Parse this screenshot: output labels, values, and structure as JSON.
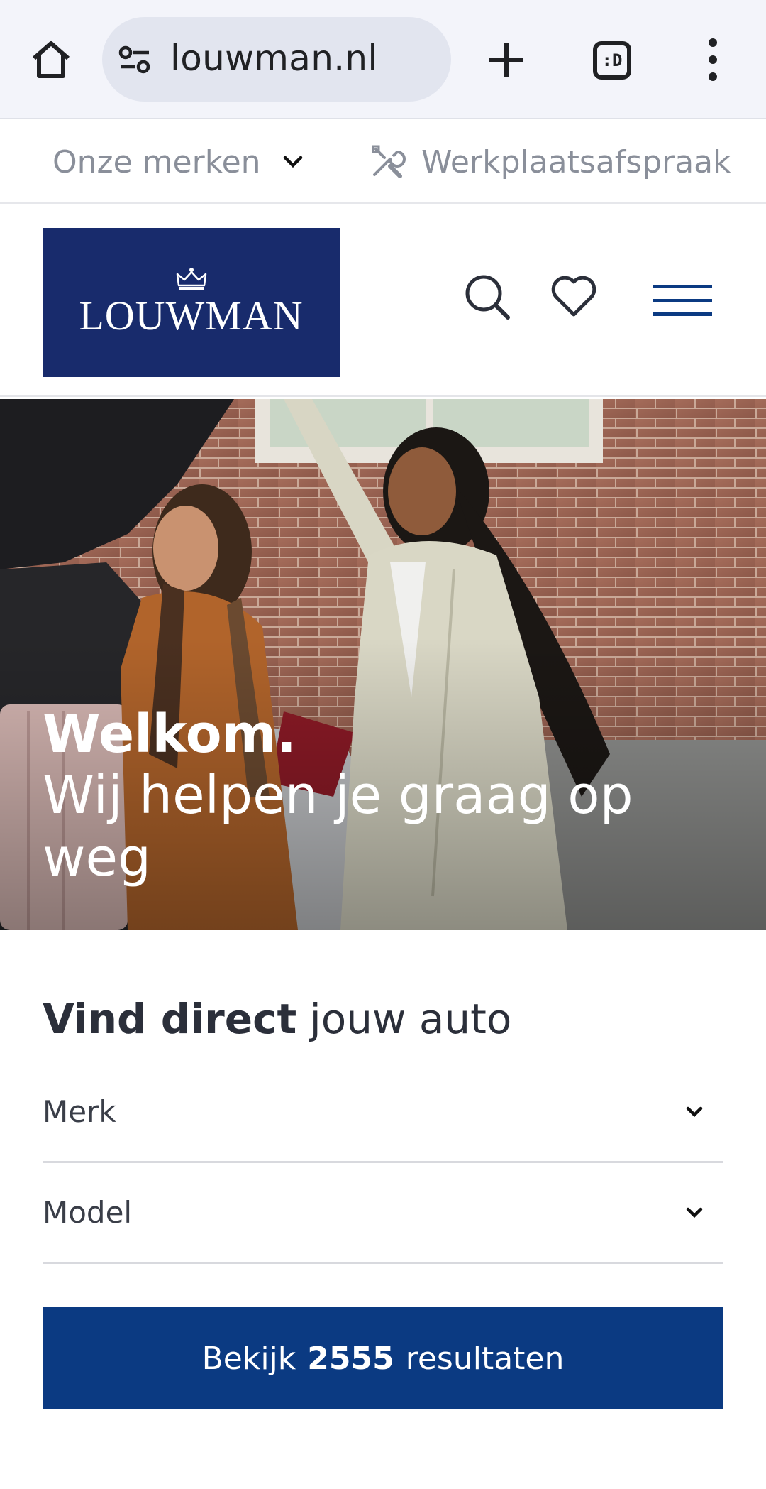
{
  "browser": {
    "url": "louwman.nl",
    "tabs_count_glyph": ":D"
  },
  "subnav": {
    "brands_label": "Onze merken",
    "workshop_label": "Werkplaatsafspraak"
  },
  "header": {
    "logo_text": "LOUWMAN"
  },
  "hero": {
    "title": "Welkom.",
    "subtitle": "Wij helpen je graag op weg"
  },
  "finder": {
    "title_bold": "Vind direct",
    "title_light": "jouw auto",
    "fields": [
      {
        "label": "Merk"
      },
      {
        "label": "Model"
      }
    ],
    "cta_prefix": "Bekijk",
    "cta_count": "2555",
    "cta_suffix": "resultaten"
  },
  "colors": {
    "brand_navy": "#182b6c",
    "cta_blue": "#0b3a82",
    "muted_text": "#8a8f9a"
  },
  "icons": {
    "home": "home-icon",
    "site_settings": "tune-icon",
    "new_tab": "plus-icon",
    "tabs": "tab-switcher-icon",
    "overflow": "more-vert-icon",
    "brands_toggle": "chevron-down-icon",
    "workshop": "wrench-screwdriver-icon",
    "search": "search-icon",
    "favorites": "heart-icon",
    "menu": "hamburger-icon",
    "logo_crown": "crown-icon"
  }
}
